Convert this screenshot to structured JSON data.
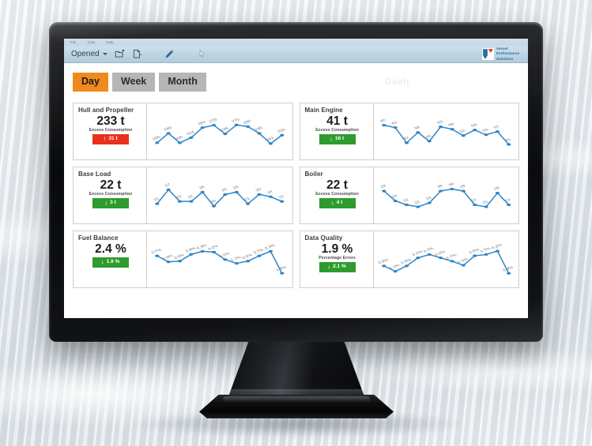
{
  "app": {
    "menubar": [
      "File",
      "View",
      "Help"
    ],
    "toolbar": {
      "opened_label": "Opened",
      "icons": [
        "open-folder-icon",
        "new-document-icon",
        "edit-pencil-icon",
        "cursor-icon"
      ]
    },
    "logo": {
      "line1": "Vessel",
      "line2": "Performance",
      "line3": "Solutions",
      "mark": "vps-logo-mark",
      "color_blue": "#2D6DA3",
      "color_red": "#E8311B"
    },
    "ghost_title": "Dash"
  },
  "period_tabs": [
    {
      "label": "Day",
      "active": true
    },
    {
      "label": "Week",
      "active": false
    },
    {
      "label": "Month",
      "active": false
    }
  ],
  "colors": {
    "accent_orange": "#F08A1E",
    "inactive_gray": "#B6B6B6",
    "line_blue": "#2E86C8",
    "badge_up_red": "#E8311B",
    "badge_down_green": "#2D9B2D"
  },
  "cards": [
    {
      "title": "Hull and Propeller",
      "value": "233 t",
      "subtitle": "Excess Consumption",
      "badge": {
        "direction": "up",
        "arrow": "↑",
        "text": "31 t"
      },
      "chart_data": {
        "type": "line",
        "title": "Hull and Propeller",
        "values": [
          205,
          240,
          205,
          224,
          261,
          270,
          238,
          271,
          265,
          240,
          202,
          233
        ],
        "unit": "t",
        "ylim": [
          190,
          285
        ],
        "grid": false,
        "labels_shown": true
      }
    },
    {
      "title": "Main Engine",
      "value": "41 t",
      "subtitle": "Excess Consumption",
      "badge": {
        "direction": "down",
        "arrow": "↓",
        "text": "16 t"
      },
      "chart_data": {
        "type": "line",
        "title": "Main Engine",
        "values": [
          65,
          62,
          43,
          56,
          45,
          63,
          60,
          52,
          59,
          53,
          57,
          41
        ],
        "unit": "t",
        "ylim": [
          38,
          70
        ],
        "grid": false,
        "labels_shown": true
      }
    },
    {
      "title": "Base Load",
      "value": "22 t",
      "subtitle": "Excess Consumption",
      "badge": {
        "direction": "down",
        "arrow": "↓",
        "text": "3 t"
      },
      "chart_data": {
        "type": "line",
        "title": "Base Load",
        "values": [
          21,
          27,
          22,
          22,
          26,
          20,
          25,
          26,
          21,
          25,
          24,
          22
        ],
        "unit": "t",
        "ylim": [
          18,
          29
        ],
        "grid": false,
        "labels_shown": true
      }
    },
    {
      "title": "Boiler",
      "value": "22 t",
      "subtitle": "Excess Consumption",
      "badge": {
        "direction": "down",
        "arrow": "↓",
        "text": "4 t"
      },
      "chart_data": {
        "type": "line",
        "title": "Boiler",
        "values": [
          29,
          24,
          22,
          21,
          23,
          29,
          30,
          29,
          22,
          21,
          28,
          22
        ],
        "unit": "t",
        "ylim": [
          19,
          32
        ],
        "grid": false,
        "labels_shown": true
      }
    },
    {
      "title": "Fuel Balance",
      "value": "2.4 %",
      "subtitle": "",
      "badge": {
        "direction": "down",
        "arrow": "↓",
        "text": "1.9 %"
      },
      "chart_data": {
        "type": "line",
        "title": "Fuel Balance",
        "values": [
          3.7,
          2.9,
          3.0,
          3.9,
          4.3,
          4.2,
          3.2,
          2.7,
          3.0,
          3.7,
          4.3,
          1.4
        ],
        "unit": "%",
        "ylim": [
          1.2,
          4.6
        ],
        "grid": false,
        "labels_shown": true
      }
    },
    {
      "title": "Data Quality",
      "value": "1.9 %",
      "subtitle": "Percentage Errors",
      "badge": {
        "direction": "down",
        "arrow": "↓",
        "text": "2.1 %"
      },
      "chart_data": {
        "type": "line",
        "title": "Data Quality",
        "values": [
          2.0,
          1.2,
          2.0,
          3.2,
          3.7,
          3.2,
          2.7,
          2.1,
          3.5,
          3.7,
          4.2,
          0.9
        ],
        "unit": "%",
        "ylim": [
          0.7,
          4.5
        ],
        "grid": false,
        "labels_shown": true
      }
    }
  ]
}
